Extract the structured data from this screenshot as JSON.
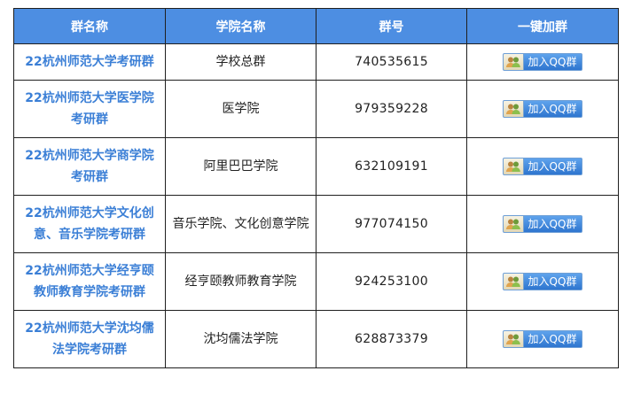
{
  "table": {
    "headers": [
      "群名称",
      "学院名称",
      "群号",
      "一键加群"
    ],
    "rows": [
      {
        "group_name": "22杭州师范大学考研群",
        "college": "学校总群",
        "group_number": "740535615",
        "join_label": "加入QQ群"
      },
      {
        "group_name": "22杭州师范大学医学院考研群",
        "college": "医学院",
        "group_number": "979359228",
        "join_label": "加入QQ群"
      },
      {
        "group_name": "22杭州师范大学商学院考研群",
        "college": "阿里巴巴学院",
        "group_number": "632109191",
        "join_label": "加入QQ群"
      },
      {
        "group_name": "22杭州师范大学文化创意、音乐学院考研群",
        "college": "音乐学院、文化创意学院",
        "group_number": "977074150",
        "join_label": "加入QQ群"
      },
      {
        "group_name": "22杭州师范大学经亨颐教师教育学院考研群",
        "college": "经亨颐教师教育学院",
        "group_number": "924253100",
        "join_label": "加入QQ群"
      },
      {
        "group_name": "22杭州师范大学沈均儒法学院考研群",
        "college": "沈均儒法学院",
        "group_number": "628873379",
        "join_label": "加入QQ群"
      }
    ]
  },
  "icons": {
    "join_button_icon": "qq-users-icon"
  },
  "colors": {
    "header_bg": "#4d8ee2",
    "link_blue": "#3b7fd6",
    "button_blue": "#2e75cf"
  }
}
